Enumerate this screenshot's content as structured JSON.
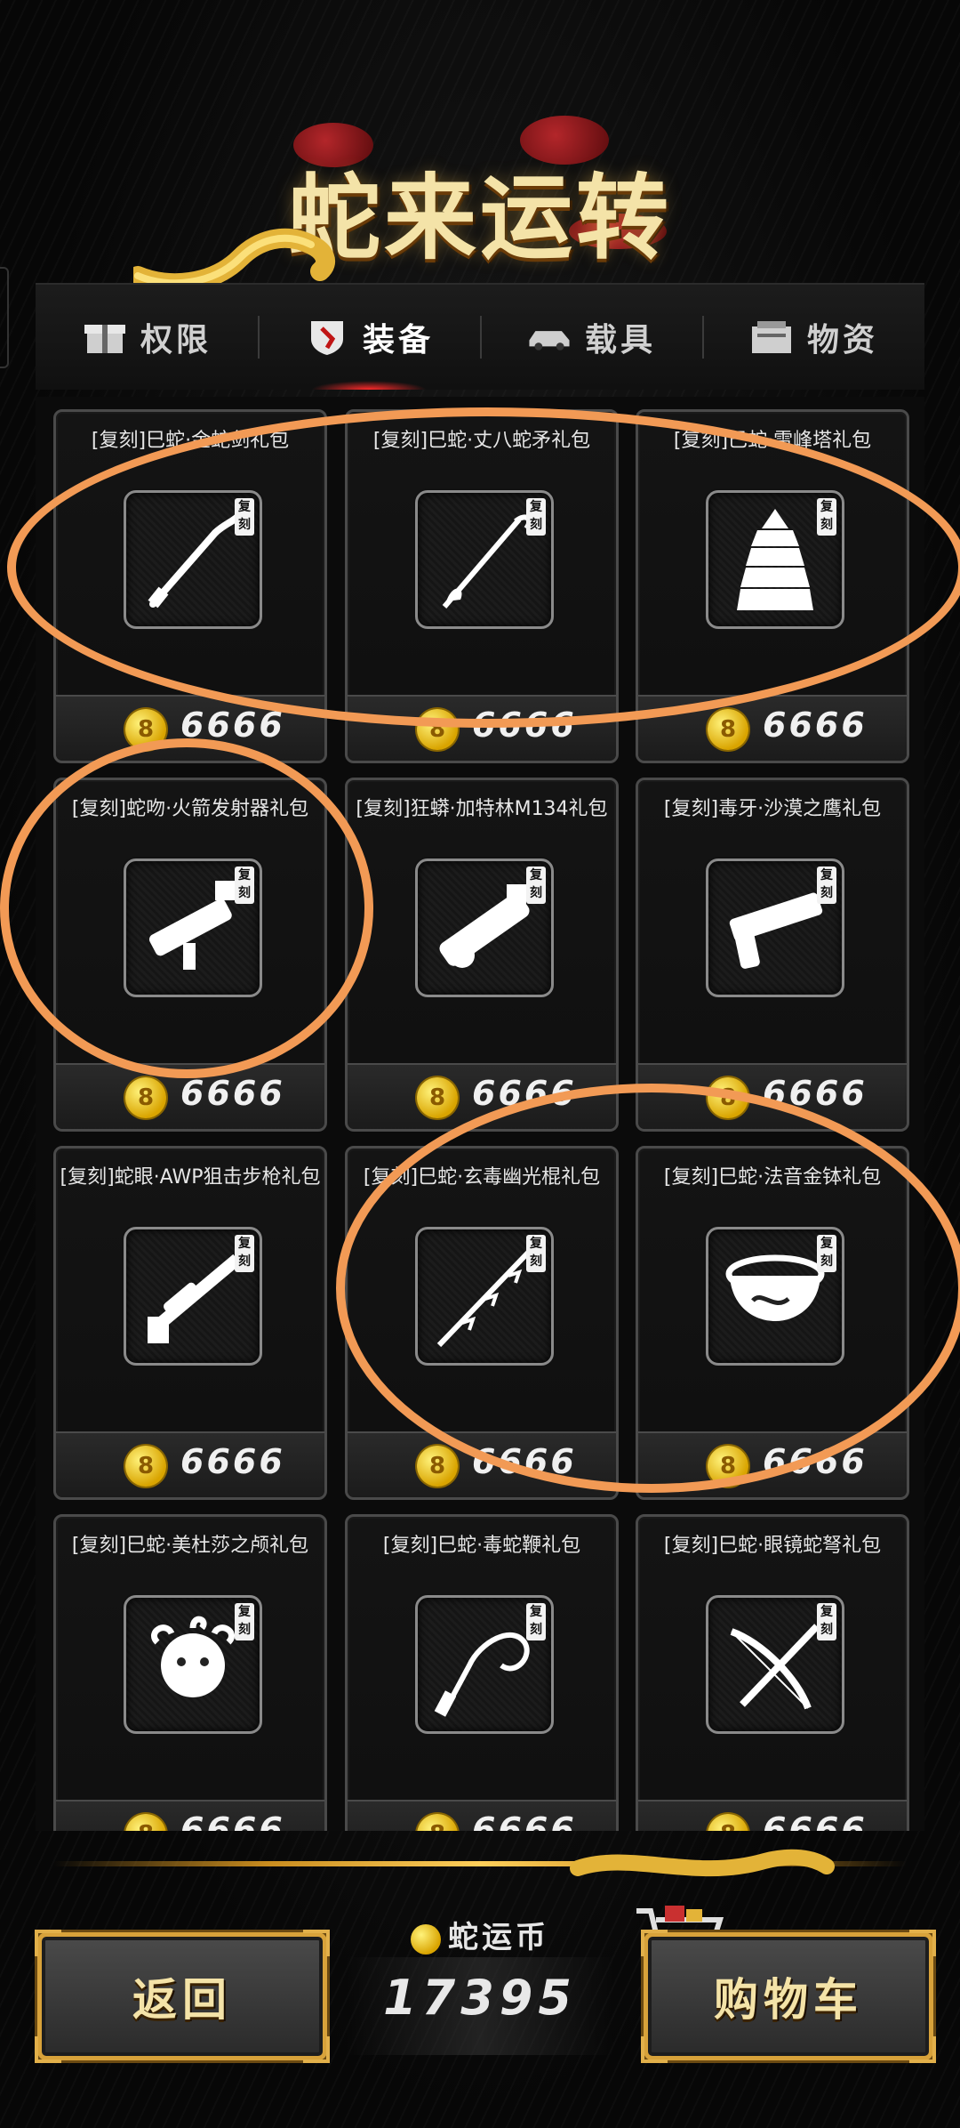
{
  "header": {
    "title": "蛇来运转"
  },
  "tabs": [
    {
      "label": "权限",
      "icon": "gift-box-icon",
      "active": false
    },
    {
      "label": "装备",
      "icon": "shield-icon",
      "active": true
    },
    {
      "label": "载具",
      "icon": "car-icon",
      "active": false
    },
    {
      "label": "物资",
      "icon": "supply-crate-icon",
      "active": false
    }
  ],
  "items": [
    {
      "title": "[复刻]巳蛇·金蛇剑礼包",
      "badge": "复刻",
      "price": "6666",
      "icon": "snake-sword-icon"
    },
    {
      "title": "[复刻]巳蛇·丈八蛇矛礼包",
      "badge": "复刻",
      "price": "6666",
      "icon": "snake-spear-icon"
    },
    {
      "title": "[复刻]巳蛇·雷峰塔礼包",
      "badge": "复刻",
      "price": "6666",
      "icon": "pagoda-icon"
    },
    {
      "title": "[复刻]蛇吻·火箭发射器礼包",
      "badge": "复刻",
      "price": "6666",
      "icon": "rocket-launcher-icon"
    },
    {
      "title": "[复刻]狂蟒·加特林M134礼包",
      "badge": "复刻",
      "price": "6666",
      "icon": "gatling-gun-icon"
    },
    {
      "title": "[复刻]毒牙·沙漠之鹰礼包",
      "badge": "复刻",
      "price": "6666",
      "icon": "pistol-icon"
    },
    {
      "title": "[复刻]蛇眼·AWP狙击步枪礼包",
      "badge": "复刻",
      "price": "6666",
      "icon": "sniper-rifle-icon"
    },
    {
      "title": "[复刻]巳蛇·玄毒幽光棍礼包",
      "badge": "复刻",
      "price": "6666",
      "icon": "staff-icon"
    },
    {
      "title": "[复刻]巳蛇·法音金钵礼包",
      "badge": "复刻",
      "price": "6666",
      "icon": "golden-bowl-icon"
    },
    {
      "title": "[复刻]巳蛇·美杜莎之颅礼包",
      "badge": "复刻",
      "price": "6666",
      "icon": "medusa-head-icon"
    },
    {
      "title": "[复刻]巳蛇·毒蛇鞭礼包",
      "badge": "复刻",
      "price": "6666",
      "icon": "whip-icon"
    },
    {
      "title": "[复刻]巳蛇·眼镜蛇弩礼包",
      "badge": "复刻",
      "price": "6666",
      "icon": "crossbow-icon"
    }
  ],
  "footer": {
    "back_label": "返回",
    "currency_label": "蛇运币",
    "currency_value": "17395",
    "cart_label": "购物车"
  },
  "colors": {
    "accent_gold": "#f4e3a8",
    "highlight_oval": "#f29a55",
    "active_tab_glow": "#ff2b2b"
  }
}
